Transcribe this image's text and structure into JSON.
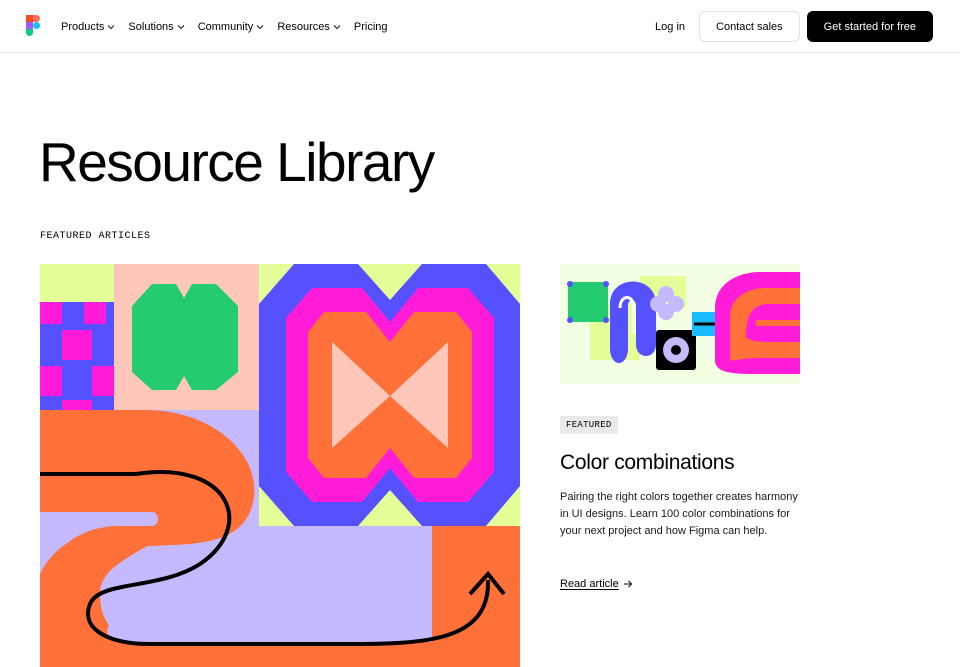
{
  "nav": {
    "logo": "figma-logo",
    "items": [
      {
        "label": "Products",
        "has_dropdown": true
      },
      {
        "label": "Solutions",
        "has_dropdown": true
      },
      {
        "label": "Community",
        "has_dropdown": true
      },
      {
        "label": "Resources",
        "has_dropdown": true
      },
      {
        "label": "Pricing",
        "has_dropdown": false
      }
    ],
    "login_label": "Log in",
    "contact_label": "Contact sales",
    "cta_label": "Get started for free"
  },
  "page": {
    "title": "Resource Library",
    "section_label": "FEATURED ARTICLES"
  },
  "featured": {
    "badge": "FEATURED",
    "title": "Color combinations",
    "description": "Pairing the right colors together creates harmony in UI designs. Learn 100 color combinations for your next project and how Figma can help.",
    "link_label": "Read article"
  },
  "colors": {
    "orange": "#ff7139",
    "lime": "#e4ff97",
    "purple": "#5551ff",
    "magenta": "#ff1bd7",
    "lavender": "#c5b9ff",
    "green": "#24cb71",
    "peach": "#ffc7ba",
    "cyan": "#1abcfe"
  }
}
